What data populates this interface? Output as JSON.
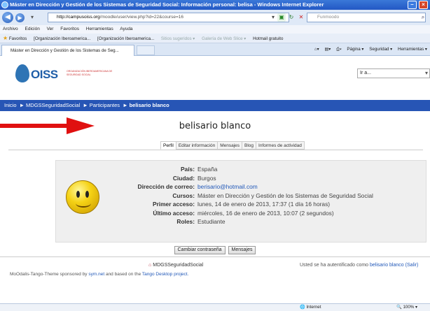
{
  "window": {
    "title": "Máster en Dirección y Gestión de los Sistemas de Seguridad Social: Información personal: belisa - Windows Internet Explorer"
  },
  "addressbar": {
    "url_host": "http://campusoiss.org",
    "url_path": "/moodle/user/view.php?id=22&course=16",
    "search_placeholder": "Funmoodo"
  },
  "menubar": [
    "Archivo",
    "Edición",
    "Ver",
    "Favoritos",
    "Herramientas",
    "Ayuda"
  ],
  "favorites": {
    "label": "Favoritos",
    "items": [
      "[Organización Iberoamerica...",
      "[Organización Iberoamerica...",
      "Sitios sugeridos ▾",
      "Galería de Web Slice ▾",
      "Hotmail gratuito"
    ]
  },
  "tab": {
    "title": "Máster en Dirección y Gestión de los Sistemas de Seg...",
    "commands": [
      "Página ▾",
      "Seguridad ▾",
      "Herramientas ▾"
    ]
  },
  "site": {
    "logo_text": "OISS",
    "logo_subtitle": "Organización Iberoamericana de Seguridad Social",
    "jump_label": "Ir a..."
  },
  "breadcrumb": [
    "Inicio",
    "MDGSSeguridadSocial",
    "Participantes",
    "belisario blanco"
  ],
  "user": {
    "fullname": "belisario blanco"
  },
  "profile_tabs": [
    "Perfil",
    "Editar información",
    "Mensajes",
    "Blog",
    "Informes de actividad"
  ],
  "profile_fields": [
    {
      "label": "País:",
      "value": "España"
    },
    {
      "label": "Ciudad:",
      "value": "Burgos"
    },
    {
      "label": "Dirección de correo:",
      "value": "berisario@hotmail.com",
      "link": true
    },
    {
      "label": "Cursos:",
      "value": "Máster en Dirección y Gestión de los Sistemas de Seguridad Social",
      "link": false
    },
    {
      "label": "Primer acceso:",
      "value": "lunes, 14 de enero de 2013, 17:37  (1 día 16 horas)"
    },
    {
      "label": "Último acceso:",
      "value": "miércoles, 16 de enero de 2013, 10:07  (2 segundos)"
    },
    {
      "label": "Roles:",
      "value": "Estudiante"
    }
  ],
  "actions": {
    "change_password": "Cambiar contraseña",
    "messages": "Mensajes"
  },
  "footer": {
    "home_link": "MDGSSeguridadSocial",
    "login_prefix": "Usted se ha autentificado como",
    "login_user": "belisario blanco",
    "logout": "(Salir)",
    "credit_prefix": "MoOdalis-Tango-Theme sponsored by",
    "credit_link1": "sym.net",
    "credit_mid": "and based on the",
    "credit_link2": "Tango Desktop project."
  },
  "statusbar": {
    "zone": "Internet",
    "zoom": "100%"
  },
  "colors": {
    "navbar": "#2755b5",
    "link": "#2158b8",
    "arrow": "#e01010"
  }
}
